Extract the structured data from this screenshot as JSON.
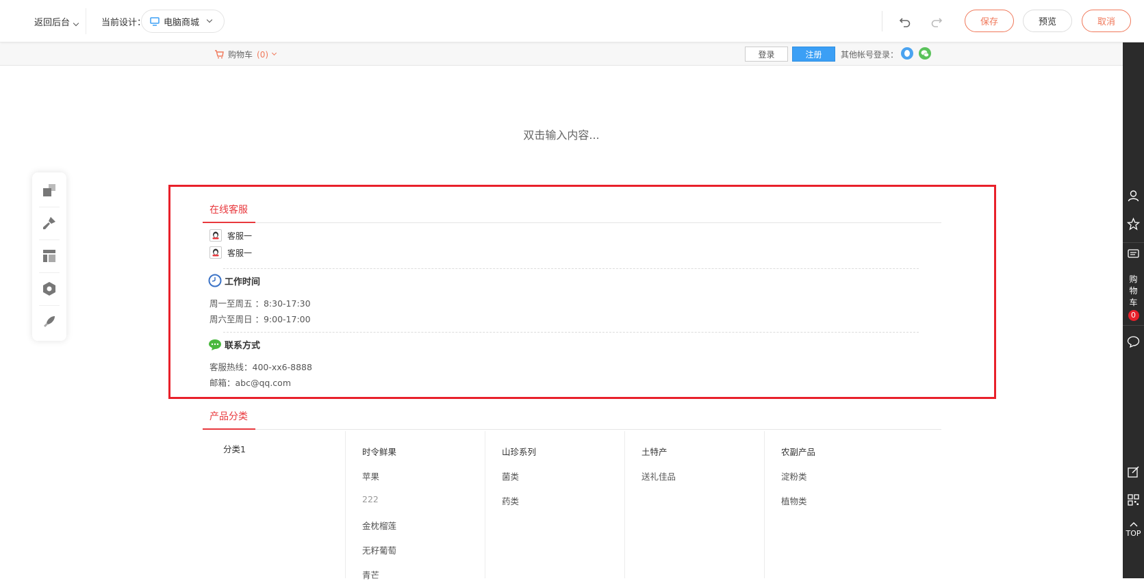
{
  "toolbar": {
    "back_label": "返回后台",
    "current_design_label": "当前设计：",
    "current_design_value": "电脑商城",
    "save_label": "保存",
    "preview_label": "预览",
    "cancel_label": "取消"
  },
  "site_header": {
    "cart_label": "购物车",
    "cart_count": "(0)",
    "login_label": "登录",
    "register_label": "注册",
    "other_login_label": "其他帐号登录："
  },
  "canvas": {
    "placeholder": "双击输入内容..."
  },
  "service": {
    "title": "在线客服",
    "agents": [
      "客服一",
      "客服一"
    ],
    "hours_title": "工作时间",
    "hours": [
      "周一至周五 ：8:30-17:30",
      "周六至周日 ：9:00-17:00"
    ],
    "contact_title": "联系方式",
    "contact": [
      "客服热线：400-xx6-8888",
      "邮箱：abc@qq.com"
    ]
  },
  "categories": {
    "title": "产品分类",
    "first_col": "分类1",
    "columns": [
      {
        "head": "时令鲜果",
        "items": [
          "苹果",
          "222",
          "金枕榴莲",
          "无籽葡萄",
          "青芒"
        ]
      },
      {
        "head": "山珍系列",
        "items": [
          "菌类",
          "药类"
        ]
      },
      {
        "head": "土特产",
        "items": [
          "送礼佳品"
        ]
      },
      {
        "head": "农副产品",
        "items": [
          "淀粉类",
          "植物类"
        ]
      }
    ]
  },
  "right_bar": {
    "cart_chars": [
      "购",
      "物",
      "车"
    ],
    "cart_badge": "0",
    "top_label": "TOP"
  },
  "colors": {
    "accent": "#f0785a",
    "selection_red": "#e8202a",
    "primary_blue": "#3b9ff5",
    "sidebar_dark": "#2b2b2b"
  },
  "icons": [
    "chevron-down-icon",
    "monitor-icon",
    "undo-icon",
    "redo-icon",
    "cart-icon",
    "qq-icon",
    "wechat-icon",
    "layers-icon",
    "brush-icon",
    "layout-icon",
    "hexagon-icon",
    "rocket-icon",
    "clock-icon",
    "chat-bubble-icon",
    "user-icon",
    "star-icon",
    "message-icon",
    "comment-icon",
    "edit-icon",
    "qrcode-icon"
  ]
}
